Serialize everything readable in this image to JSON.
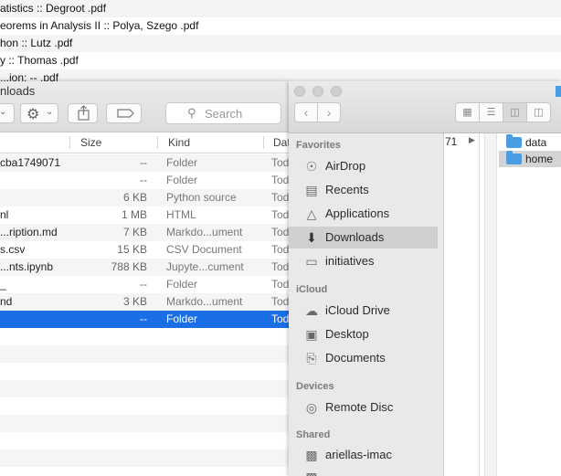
{
  "background_list": {
    "rows": [
      {
        "name": "atistics :: Degroot .pdf"
      },
      {
        "name": "eorems in Analysis II :: Polya, Szego .pdf"
      },
      {
        "name": "hon :: Lutz .pdf"
      },
      {
        "name": "y :: Thomas .pdf"
      },
      {
        "name": "...ion: -- .pdf"
      }
    ]
  },
  "left_window": {
    "title": "nloads",
    "search_placeholder": "Search",
    "columns": {
      "size": "Size",
      "kind": "Kind",
      "date": "Dat"
    },
    "rows": [
      {
        "name": "cba1749071",
        "size": "--",
        "kind": "Folder",
        "date": "Tod"
      },
      {
        "name": "",
        "size": "--",
        "kind": "Folder",
        "date": "Tod"
      },
      {
        "name": "",
        "size": "6 KB",
        "kind": "Python source",
        "date": "Tod"
      },
      {
        "name": "nl",
        "size": "1 MB",
        "kind": "HTML",
        "date": "Tod"
      },
      {
        "name": "...ription.md",
        "size": "7 KB",
        "kind": "Markdo...ument",
        "date": "Tod"
      },
      {
        "name": "s.csv",
        "size": "15 KB",
        "kind": "CSV Document",
        "date": "Tod"
      },
      {
        "name": "...nts.ipynb",
        "size": "788 KB",
        "kind": "Jupyte...cument",
        "date": "Tod"
      },
      {
        "name": "_",
        "size": "--",
        "kind": "Folder",
        "date": "Tod"
      },
      {
        "name": "nd",
        "size": "3 KB",
        "kind": "Markdo...ument",
        "date": "Tod"
      },
      {
        "name": "",
        "size": "--",
        "kind": "Folder",
        "date": "Tod"
      }
    ]
  },
  "right_window": {
    "sidebar": {
      "favorites_header": "Favorites",
      "favorites": [
        {
          "label": "AirDrop",
          "icon": "airdrop-icon"
        },
        {
          "label": "Recents",
          "icon": "recents-icon"
        },
        {
          "label": "Applications",
          "icon": "applications-icon"
        },
        {
          "label": "Downloads",
          "icon": "downloads-icon"
        },
        {
          "label": "initiatives",
          "icon": "folder-icon"
        }
      ],
      "icloud_header": "iCloud",
      "icloud": [
        {
          "label": "iCloud Drive",
          "icon": "cloud-icon"
        },
        {
          "label": "Desktop",
          "icon": "desktop-icon"
        },
        {
          "label": "Documents",
          "icon": "documents-icon"
        }
      ],
      "devices_header": "Devices",
      "devices": [
        {
          "label": "Remote Disc",
          "icon": "disc-icon"
        }
      ],
      "shared_header": "Shared",
      "shared": [
        {
          "label": "ariellas-imac",
          "icon": "computer-icon"
        },
        {
          "label": "...",
          "icon": "computer-icon"
        }
      ]
    },
    "column_view": {
      "prev_column_text": "71",
      "items": [
        {
          "label": "data"
        },
        {
          "label": "home"
        }
      ]
    }
  }
}
